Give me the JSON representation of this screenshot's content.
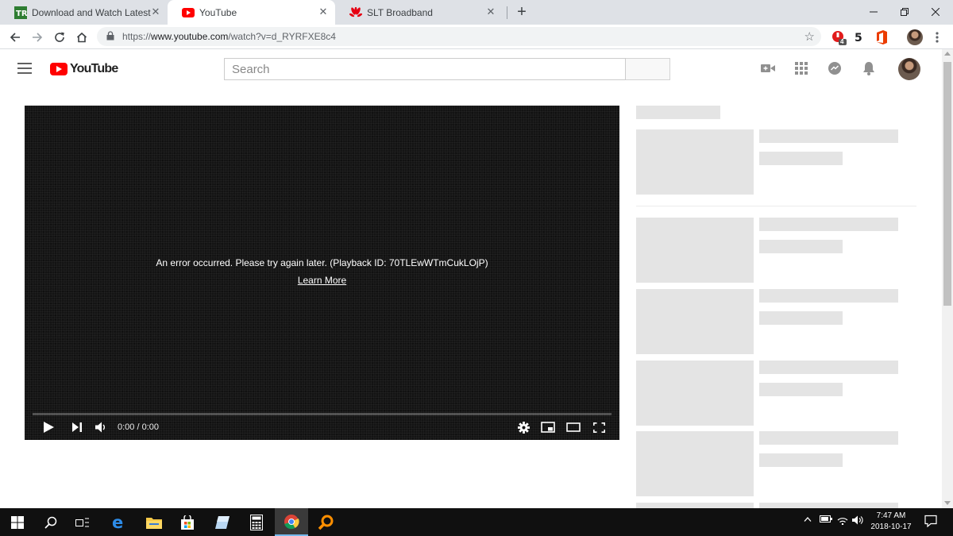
{
  "browser": {
    "tabs": [
      {
        "title": "Download and Watch Latest Tam",
        "icon": "tamilrockers-favicon"
      },
      {
        "title": "YouTube",
        "icon": "youtube-favicon"
      },
      {
        "title": "SLT Broadband",
        "icon": "huawei-favicon"
      }
    ],
    "address": {
      "scheme": "https://",
      "host": "www.youtube.com",
      "path": "/watch?v=d_RYRFXE8c4"
    },
    "extension_badge": "4"
  },
  "youtube": {
    "logo_text": "YouTube",
    "search": {
      "placeholder": "Search",
      "value": ""
    }
  },
  "player": {
    "error_message": "An error occurred. Please try again later. (Playback ID: 70TLEwWTmCukLOjP)",
    "learn_more": "Learn More",
    "time": "0:00 / 0:00",
    "progress": 0
  },
  "colors": {
    "youtube_red": "#ff0000",
    "taskbar_bg": "#101010",
    "placeholder_gray": "#e4e4e4"
  },
  "taskbar": {
    "time": "7:47 AM",
    "date": "2018-10-17"
  }
}
